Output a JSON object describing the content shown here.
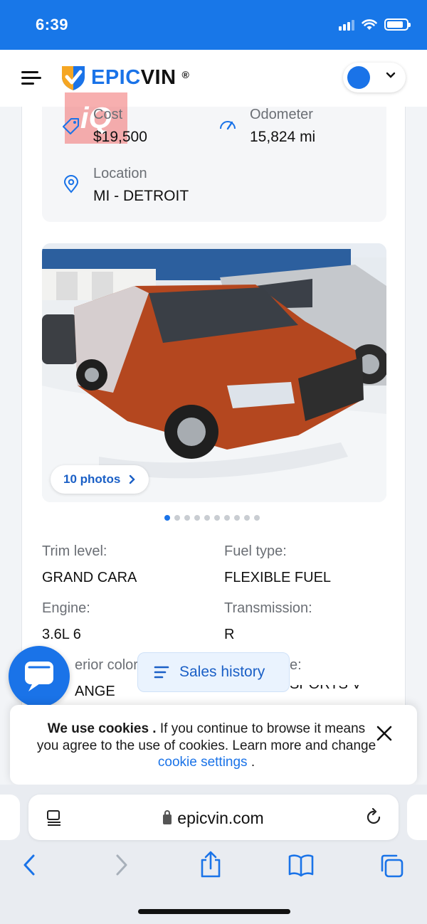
{
  "status_bar": {
    "time": "6:39",
    "battery_level": 0.85
  },
  "header": {
    "logo_part1": "EPIC",
    "logo_part2": "VIN",
    "logo_registered": "®",
    "accent_color": "#1a73e8"
  },
  "vehicle_info": {
    "cost_label": "Cost",
    "cost_value": "$19,500",
    "odometer_label": "Odometer",
    "odometer_value": "15,824 mi",
    "location_label": "Location",
    "location_value": "MI - DETROIT",
    "watermark": "iQ"
  },
  "photos": {
    "button_label": "10 photos",
    "count": 10,
    "active_index": 0
  },
  "specs": {
    "trim_label": "Trim level:",
    "trim_value": "GRAND CARA",
    "fuel_label": "Fuel type:",
    "fuel_value": "FLEXIBLE FUEL",
    "engine_label": "Engine:",
    "engine_value": "3.6L 6",
    "transmission_label": "Transmission:",
    "transmission_value": "R",
    "ext_color_label_partial": "erior color:",
    "ext_color_value_partial": "ANGE",
    "style_label_partial": "e:",
    "style_value_partial": "SPORTS V"
  },
  "sales_history": {
    "label": "Sales history"
  },
  "cookie": {
    "bold": "We use cookies .",
    "text": " If you continue to browse it means you agree to the use of cookies. Learn more and change ",
    "link": "cookie settings",
    "end": " ."
  },
  "browser": {
    "url": "epicvin.com"
  }
}
